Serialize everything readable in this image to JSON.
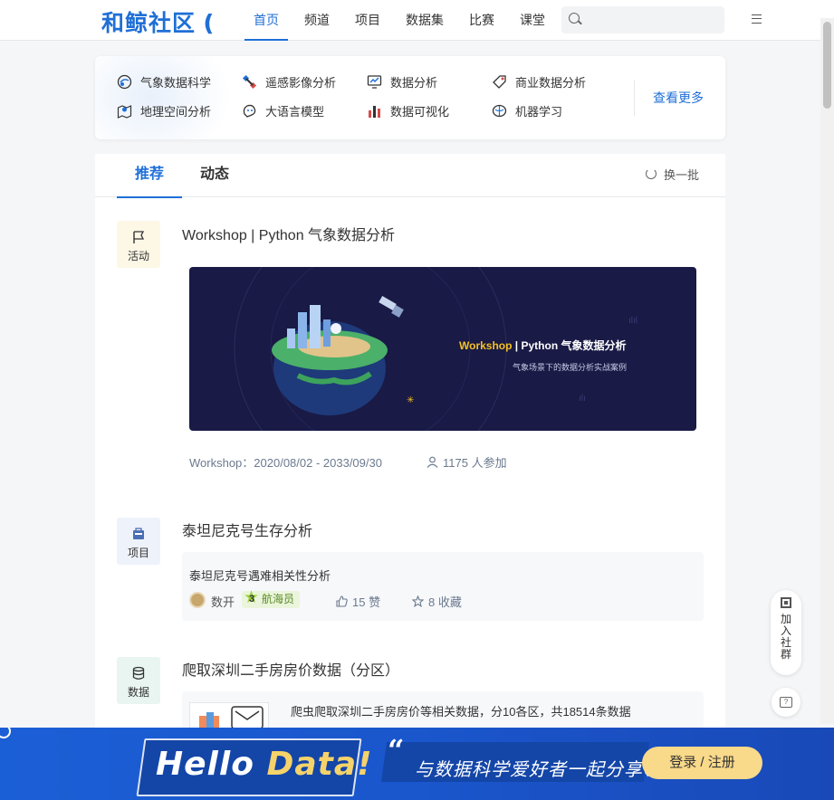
{
  "header": {
    "logo": "和鲸社区",
    "nav": [
      "首页",
      "频道",
      "项目",
      "数据集",
      "比赛",
      "课堂"
    ],
    "search_placeholder": ""
  },
  "categories": {
    "items": [
      {
        "label": "气象数据科学",
        "icon": "weather-icon"
      },
      {
        "label": "遥感影像分析",
        "icon": "satellite-icon"
      },
      {
        "label": "数据分析",
        "icon": "chart-monitor-icon"
      },
      {
        "label": "商业数据分析",
        "icon": "tag-icon"
      },
      {
        "label": "地理空间分析",
        "icon": "map-pin-icon"
      },
      {
        "label": "大语言模型",
        "icon": "brain-chat-icon"
      },
      {
        "label": "数据可视化",
        "icon": "bar-chart-icon"
      },
      {
        "label": "机器学习",
        "icon": "brain-icon"
      }
    ],
    "more": "查看更多"
  },
  "feed": {
    "tabs": [
      "推荐",
      "动态"
    ],
    "refresh": "换一批",
    "items": [
      {
        "type": "活动",
        "title": "Workshop | Python 气象数据分析",
        "banner_title_hl": "Workshop",
        "banner_title": " | Python 气象数据分析",
        "banner_sub": "气象场景下的数据分析实战案例",
        "date": "Workshop：2020/08/02 - 2033/09/30",
        "participants": "1175 人参加"
      },
      {
        "type": "项目",
        "title": "泰坦尼克号生存分析",
        "desc": "泰坦尼克号遇难相关性分析",
        "author": "数开",
        "rank_level": "3",
        "rank": "航海员",
        "likes": "15 赞",
        "favorites": "8 收藏"
      },
      {
        "type": "数据",
        "title": "爬取深圳二手房房价数据（分区）",
        "desc": "爬虫爬取深圳二手房房价等相关数据，分10各区，共18514条数据"
      }
    ]
  },
  "side": {
    "join_group": "加入社群"
  },
  "bottom_banner": {
    "hello": "Hello ",
    "data": "Data!",
    "quote": "“",
    "slogan": "与数据科学爱好者一起分享、",
    "login": "登录 / 注册"
  },
  "colors": {
    "brand": "#1f6fd6",
    "banner_bg": "#191a45",
    "accent_yellow": "#f5c122"
  }
}
